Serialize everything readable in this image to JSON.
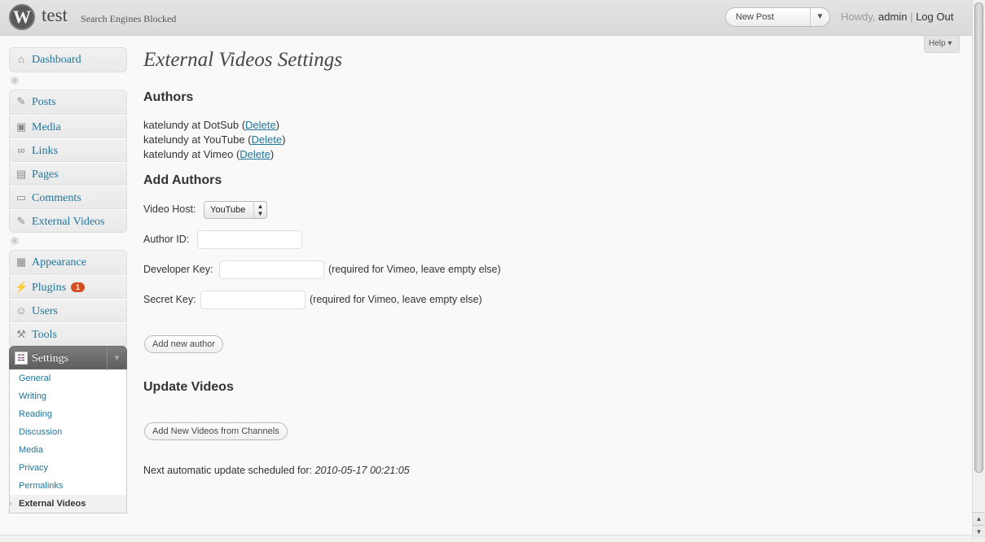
{
  "header": {
    "logo_text": "W",
    "site_title": "test",
    "site_subtitle": "Search Engines Blocked",
    "favorite_action": "New Post",
    "favorite_toggle": "▼",
    "howdy": "Howdy,",
    "username": "admin",
    "separator": "|",
    "logout": "Log Out"
  },
  "help_label": "Help ▾",
  "menu": {
    "dashboard": "Dashboard",
    "posts": "Posts",
    "media": "Media",
    "links": "Links",
    "pages": "Pages",
    "comments": "Comments",
    "external_videos": "External Videos",
    "appearance": "Appearance",
    "plugins": "Plugins",
    "plugins_badge": "1",
    "users": "Users",
    "tools": "Tools",
    "settings": "Settings",
    "settings_submenu": [
      "General",
      "Writing",
      "Reading",
      "Discussion",
      "Media",
      "Privacy",
      "Permalinks",
      "External Videos"
    ]
  },
  "page": {
    "title": "External Videos Settings",
    "authors_heading": "Authors",
    "authors": [
      {
        "text": "katelundy at DotSub (",
        "action": "Delete",
        "close": ")"
      },
      {
        "text": "katelundy at YouTube (",
        "action": "Delete",
        "close": ")"
      },
      {
        "text": "katelundy at Vimeo (",
        "action": "Delete",
        "close": ")"
      }
    ],
    "add_authors_heading": "Add Authors",
    "video_host_label": "Video Host:",
    "video_host_value": "YouTube",
    "author_id_label": "Author ID:",
    "author_id_value": "",
    "developer_key_label": "Developer Key:",
    "developer_key_value": "",
    "developer_key_hint": "(required for Vimeo, leave empty else)",
    "secret_key_label": "Secret Key:",
    "secret_key_value": "",
    "secret_key_hint": "(required for Vimeo, leave empty else)",
    "add_author_button": "Add new author",
    "update_videos_heading": "Update Videos",
    "add_videos_button": "Add New Videos from Channels",
    "next_update_label": "Next automatic update scheduled for:",
    "next_update_value": "2010-05-17 00:21:05"
  },
  "colors": {
    "link": "#21759b",
    "badge": "#d54e21",
    "active_menu": "#6d6d6d"
  }
}
